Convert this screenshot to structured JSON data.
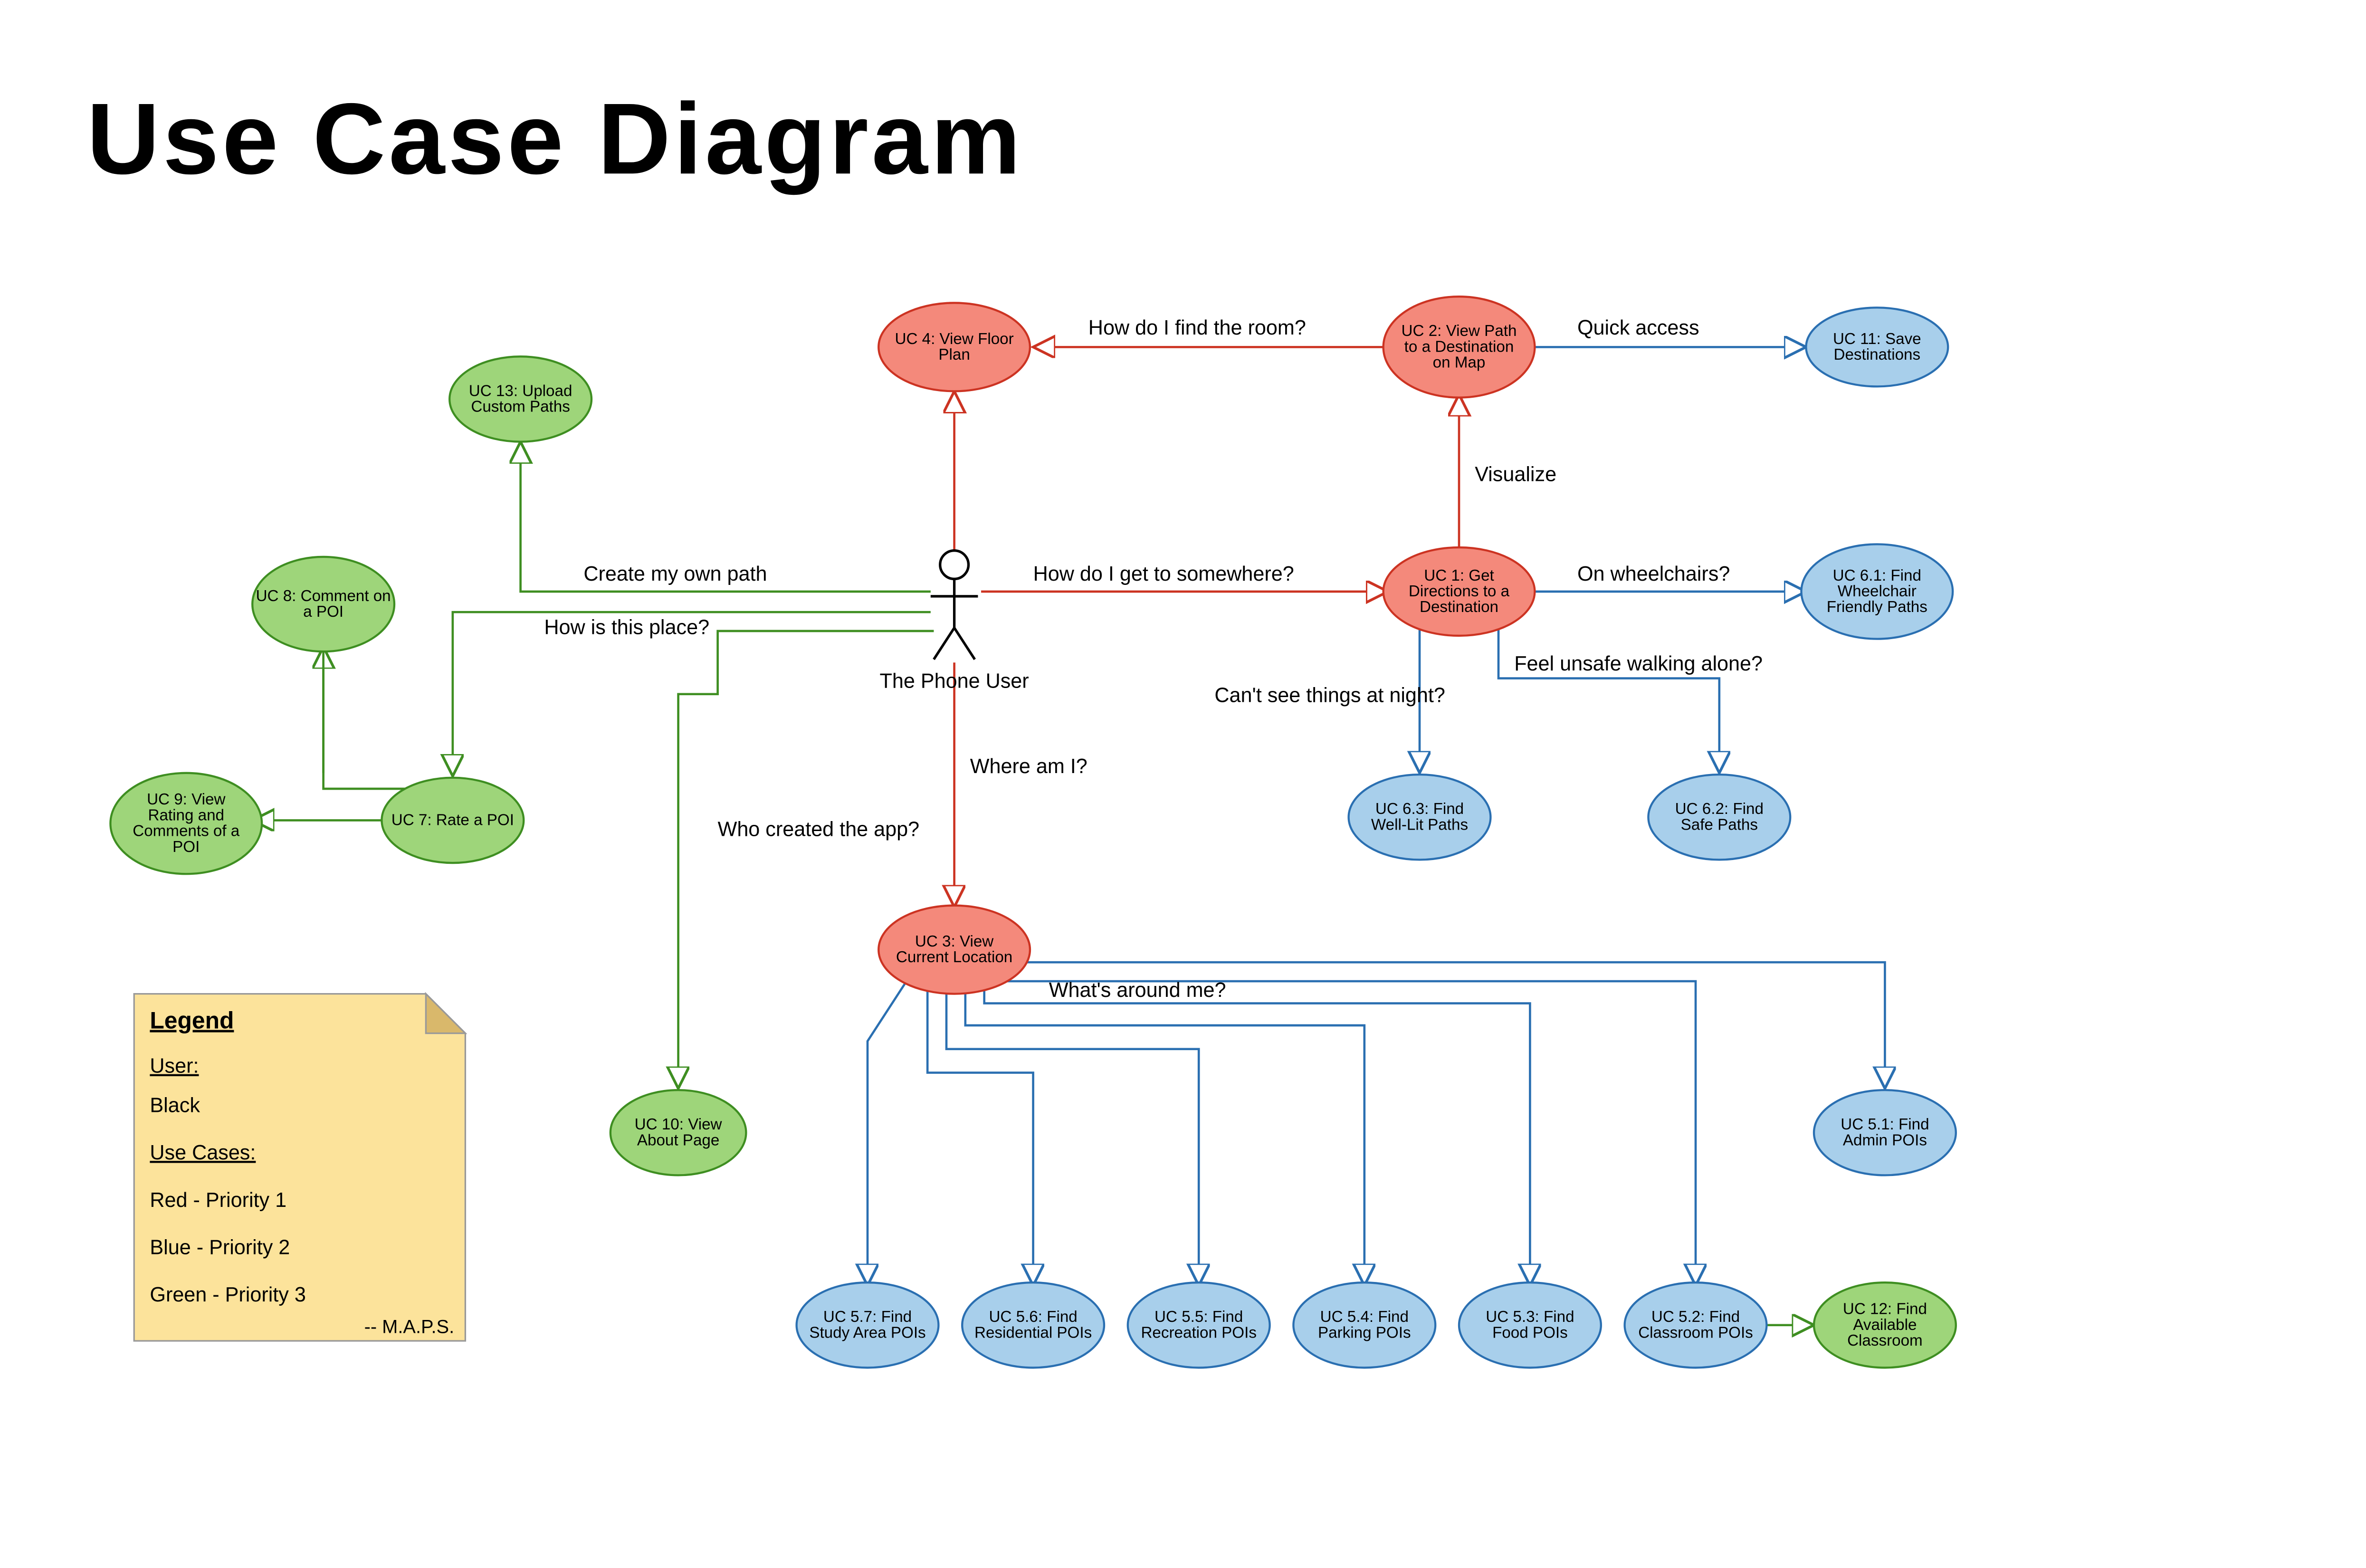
{
  "title": "Use Case Diagram",
  "actor": {
    "label": "The Phone User"
  },
  "colors": {
    "red": {
      "fill": "#f4897b",
      "stroke": "#cc3322"
    },
    "blue": {
      "fill": "#a8cfeb",
      "stroke": "#2a6fb1"
    },
    "green": {
      "fill": "#9ed57a",
      "stroke": "#3e8e21"
    },
    "note": {
      "fill": "#fce39b",
      "stroke": "#999999"
    }
  },
  "use_cases": {
    "uc1": {
      "label": "UC 1: Get Directions to a Destination",
      "color": "red"
    },
    "uc2": {
      "label": "UC 2: View Path to a Destination on Map",
      "color": "red"
    },
    "uc3": {
      "label": "UC 3: View Current Location",
      "color": "red"
    },
    "uc4": {
      "label": "UC 4: View Floor Plan",
      "color": "red"
    },
    "uc51": {
      "label": "UC 5.1: Find Admin POIs",
      "color": "blue"
    },
    "uc52": {
      "label": "UC 5.2: Find Classroom POIs",
      "color": "blue"
    },
    "uc53": {
      "label": "UC 5.3: Find Food POIs",
      "color": "blue"
    },
    "uc54": {
      "label": "UC 5.4: Find Parking POIs",
      "color": "blue"
    },
    "uc55": {
      "label": "UC 5.5: Find Recreation POIs",
      "color": "blue"
    },
    "uc56": {
      "label": "UC 5.6: Find Residential POIs",
      "color": "blue"
    },
    "uc57": {
      "label": "UC 5.7: Find Study Area POIs",
      "color": "blue"
    },
    "uc61": {
      "label": "UC 6.1: Find Wheelchair Friendly Paths",
      "color": "blue"
    },
    "uc62": {
      "label": "UC 6.2: Find Safe Paths",
      "color": "blue"
    },
    "uc63": {
      "label": "UC 6.3: Find Well-Lit Paths",
      "color": "blue"
    },
    "uc7": {
      "label": "UC 7: Rate a POI",
      "color": "green"
    },
    "uc8": {
      "label": "UC 8: Comment on a POI",
      "color": "green"
    },
    "uc9": {
      "label": "UC 9: View Rating and Comments of a POI",
      "color": "green"
    },
    "uc10": {
      "label": "UC 10: View About Page",
      "color": "green"
    },
    "uc11": {
      "label": "UC 11: Save Destinations",
      "color": "blue"
    },
    "uc12": {
      "label": "UC 12: Find Available Classroom",
      "color": "green"
    },
    "uc13": {
      "label": "UC 13: Upload Custom Paths",
      "color": "green"
    }
  },
  "edges": {
    "e_user_uc1": {
      "label": "How do I get to somewhere?"
    },
    "e_uc1_uc2": {
      "label": "Visualize"
    },
    "e_uc2_uc4": {
      "label": "How do I find the room?"
    },
    "e_uc2_uc11": {
      "label": "Quick access"
    },
    "e_uc1_uc61": {
      "label": "On wheelchairs?"
    },
    "e_uc1_uc62": {
      "label": "Feel unsafe walking alone?"
    },
    "e_uc1_uc63": {
      "label": "Can't see things at night?"
    },
    "e_user_uc3": {
      "label": "Where am I?"
    },
    "e_uc3_fan": {
      "label": "What's around me?"
    },
    "e_user_uc4": {
      "label": ""
    },
    "e_user_uc13": {
      "label": "Create my own path"
    },
    "e_user_uc7": {
      "label": "How is this place?"
    },
    "e_user_uc10": {
      "label": "Who created the app?"
    }
  },
  "legend": {
    "title": "Legend",
    "rows": [
      "User:",
      "Black",
      "Use Cases:",
      "Red - Priority 1",
      "Blue - Priority 2",
      "Green - Priority 3"
    ],
    "signature": "-- M.A.P.S."
  }
}
